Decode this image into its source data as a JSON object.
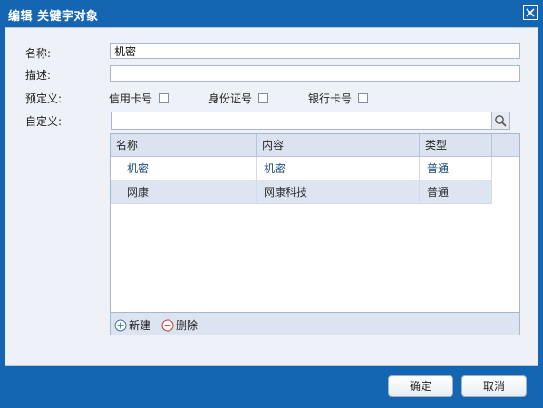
{
  "dialog": {
    "title": "编辑 关键字对象",
    "close_icon": "close-icon"
  },
  "form": {
    "name_label": "名称:",
    "name_value": "机密",
    "desc_label": "描述:",
    "desc_value": "",
    "preset_label": "预定义:",
    "presets": [
      {
        "label": "信用卡号",
        "checked": false
      },
      {
        "label": "身份证号",
        "checked": false
      },
      {
        "label": "银行卡号",
        "checked": false
      }
    ],
    "custom_label": "自定义:",
    "search_value": "",
    "search_icon": "search-icon"
  },
  "grid": {
    "columns": [
      "名称",
      "内容",
      "类型"
    ],
    "rows": [
      {
        "name": "机密",
        "content": "机密",
        "type": "普通",
        "selected": false
      },
      {
        "name": "网康",
        "content": "网康科技",
        "type": "普通",
        "selected": true
      }
    ],
    "toolbar": {
      "add_label": "新建",
      "delete_label": "删除"
    }
  },
  "footer": {
    "ok_label": "确定",
    "cancel_label": "取消"
  },
  "colors": {
    "frame": "#1566b2",
    "panel": "#eef2f8",
    "header": "#dae3ef",
    "selected_row": "#dde5f0"
  }
}
